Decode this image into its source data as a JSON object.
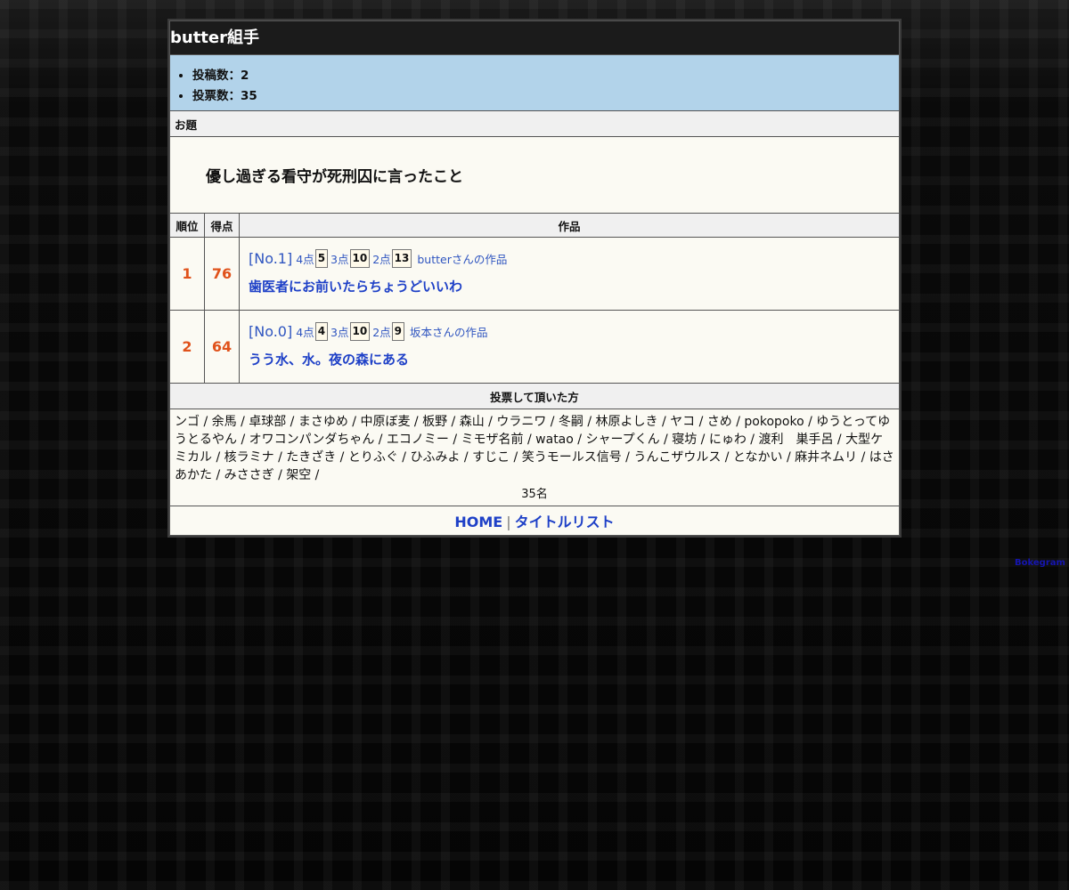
{
  "page": {
    "title": "butter組手"
  },
  "stats": [
    {
      "label": "投稿数：2"
    },
    {
      "label": "投票数：35"
    }
  ],
  "odai": {
    "heading": "お題",
    "text": "優し過ぎる看守が死刑囚に言ったこと"
  },
  "results_table": {
    "headers": {
      "rank": "順位",
      "score": "得点",
      "work": "作品"
    },
    "rows": [
      {
        "rank": "1",
        "score": "76",
        "entry_no": "[No.1]",
        "p4_label": "4点",
        "p4": "5",
        "p3_label": "3点",
        "p3": "10",
        "p2_label": "2点",
        "p2": "13",
        "author": "butterさんの作品",
        "title": "歯医者にお前いたらちょうどいいわ"
      },
      {
        "rank": "2",
        "score": "64",
        "entry_no": "[No.0]",
        "p4_label": "4点",
        "p4": "4",
        "p3_label": "3点",
        "p3": "10",
        "p2_label": "2点",
        "p2": "9",
        "author": "坂本さんの作品",
        "title": "うう水、水。夜の森にある"
      }
    ]
  },
  "voters": {
    "heading": "投票して頂いた方",
    "list": "ンゴ / 余馬 / 卓球部 / まさゆめ / 中原ぼ麦 / 板野 / 森山 / ウラニワ / 冬嗣 / 林原よしき / ヤコ / さめ / pokopoko / ゆうとってゆうとるやん / オワコンパンダちゃん / エコノミー / ミモザ名前 / watao / シャープくん / 寝坊 / にゅわ / 渡利　巣手呂 / 大型ケミカル / 核ラミナ / たきざき / とりふぐ / ひふみよ / すじこ / 笑うモールス信号 / うんこザウルス / となかい / 麻井ネムリ / はさあかた / みささぎ / 架空 /",
    "count": "35名"
  },
  "footer": {
    "home": "HOME",
    "separator": "|",
    "title_list": "タイトルリスト"
  },
  "credit": "Bokegram",
  "colors": {
    "accent": "#e0521b",
    "link": "#1e40c7",
    "stats_bg": "#b2d3ea",
    "title_bg": "#1b1b1b"
  }
}
